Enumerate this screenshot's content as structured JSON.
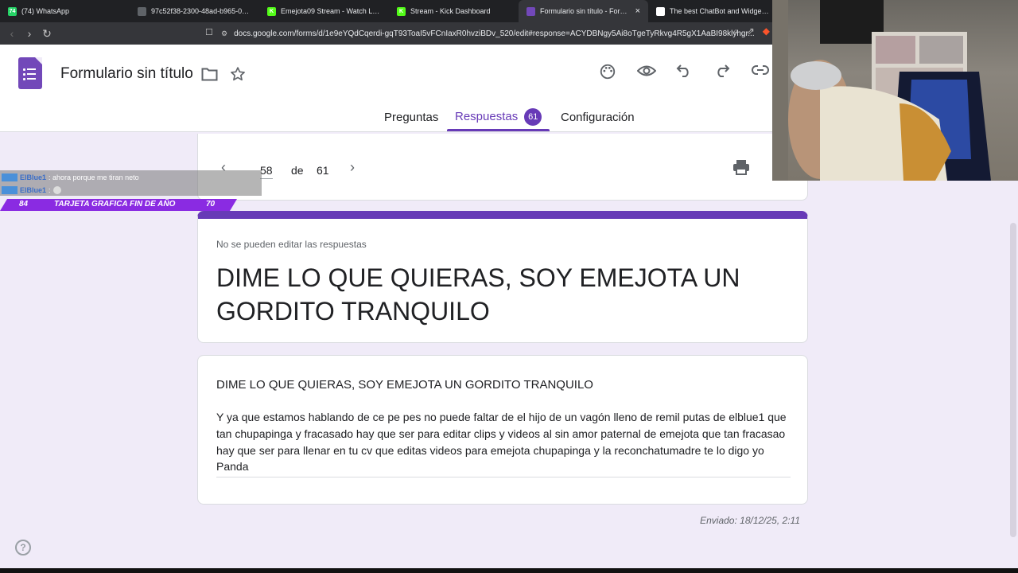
{
  "browser": {
    "tabs": [
      {
        "title": "(74) WhatsApp",
        "favicon_color": "#25d366",
        "favicon_text": "74",
        "active": false
      },
      {
        "title": "97c52f38-2300-48ad-b965-0c212b6",
        "favicon_color": "#5f6368",
        "favicon_text": "",
        "active": false
      },
      {
        "title": "Emejota09 Stream - Watch Live o",
        "favicon_color": "#53fc18",
        "favicon_text": "K",
        "active": false
      },
      {
        "title": "Stream - Kick Dashboard",
        "favicon_color": "#53fc18",
        "favicon_text": "K",
        "active": false
      },
      {
        "title": "Formulario sin título - Formulari",
        "favicon_color": "#7248b9",
        "favicon_text": "",
        "active": true
      },
      {
        "title": "The best ChatBot and Widgets for K",
        "favicon_color": "#ffffff",
        "favicon_text": "",
        "active": false
      }
    ],
    "url": "docs.google.com/forms/d/1e9eYQdCqerdi-gqT93ToaI5vFCnIaxR0hvziBDv_520/edit#response=ACYDBNgy5Ai8oTgeTyRkvg4R5gX1AaBI98klyhgr..."
  },
  "header": {
    "form_title": "Formulario sin título",
    "tabs": {
      "questions": "Preguntas",
      "responses": "Respuestas",
      "responses_count": "61",
      "settings": "Configuración"
    }
  },
  "pager": {
    "current": "58",
    "of_label": "de",
    "total": "61"
  },
  "response": {
    "notice": "No se pueden editar las respuestas",
    "form_heading": "DIME LO QUE QUIERAS, SOY EMEJOTA UN GORDITO TRANQUILO",
    "question": "DIME LO QUE QUIERAS, SOY EMEJOTA UN GORDITO TRANQUILO",
    "answer": "Y ya que estamos hablando de ce pe pes no puede faltar de el hijo de un vagón lleno de remil putas de elblue1 que tan chupapinga y fracasado hay que ser para editar clips y videos al sin amor paternal de emejota que tan fracasao hay que ser para llenar en tu cv que editas videos para emejota chupapinga y la reconchatumadre te lo digo yo Panda",
    "submitted": "Enviado: 18/12/25, 2:11"
  },
  "overlay": {
    "chat": [
      {
        "user": "ElBlue1",
        "text": ": ahora porque me tiran neto"
      },
      {
        "user": "ElBlue1",
        "text": ":"
      }
    ],
    "poll": {
      "left_value": "84",
      "label": "TARJETA GRAFICA FIN DE AÑO",
      "right_value": "70"
    }
  },
  "colors": {
    "accent": "#673ab7",
    "page_bg": "#f0ebf8"
  }
}
